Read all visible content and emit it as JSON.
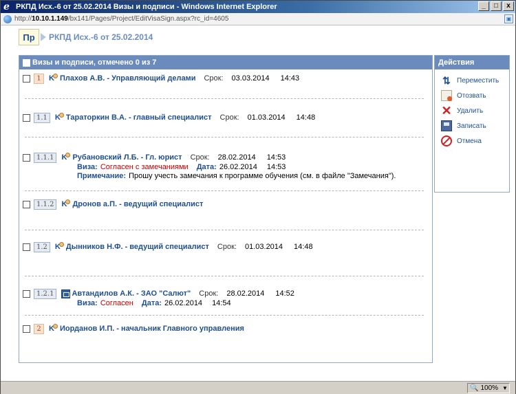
{
  "window": {
    "title": "РКПД Исх.-6 от 25.02.2014 Визы и подписи - Windows Internet Explorer",
    "controls": [
      "_",
      "□",
      "x"
    ]
  },
  "address": {
    "prefix": "http://",
    "host": "10.10.1.149",
    "path": "/bx141/Pages/Project/EditVisaSign.aspx?rc_id=4605"
  },
  "doc": {
    "badge": "Пр",
    "title": "РКПД Исх.-6 от 25.02.2014"
  },
  "panel": {
    "header": "Визы и подписи, отмечено 0 из 7",
    "rows": [
      {
        "num": "1",
        "name": "Плахов А.В. - Управляющий делами",
        "term_label": "Срок:",
        "date": "03.03.2014",
        "time": "14:43"
      },
      {
        "num": "1.1",
        "name": "Тараторкин В.А. - главный специалист",
        "term_label": "Срок:",
        "date": "01.03.2014",
        "time": "14:48"
      },
      {
        "num": "1.1.1",
        "name": "Рубановский Л.Б. - Гл. юрист",
        "term_label": "Срок:",
        "date": "28.02.2014",
        "time": "14:53",
        "visa_label": "Виза:",
        "visa_value": "Согласен с замечаниями",
        "visa_date_label": "Дата:",
        "visa_date": "26.02.2014",
        "visa_time": "14:53",
        "note_label": "Примечание:",
        "note": "Прошу учесть замечания к программе обучения (см. в файле \"Замечания\")."
      },
      {
        "num": "1.1.2",
        "name": "Дронов а.П. - ведущий специалист"
      },
      {
        "num": "1.2",
        "name": "Дынников Н.Ф. - ведущий специалист",
        "term_label": "Срок:",
        "date": "01.03.2014",
        "time": "14:48"
      },
      {
        "num": "1.2.1",
        "name": "Автандилов А.К. - ЗАО \"Салют\"",
        "term_label": "Срок:",
        "date": "28.02.2014",
        "time": "14:52",
        "visa_label": "Виза:",
        "visa_value": "Согласен",
        "visa_date_label": "Дата:",
        "visa_date": "26.02.2014",
        "visa_time": "14:54"
      },
      {
        "num": "2",
        "name": "Иорданов И.П. - начальник Главного управления"
      }
    ]
  },
  "actions": {
    "header": "Действия",
    "items": [
      {
        "label": "Переместить",
        "icon": "move-icon"
      },
      {
        "label": "Отозвать",
        "icon": "recall-icon"
      },
      {
        "label": "Удалить",
        "icon": "delete-icon"
      },
      {
        "label": "Записать",
        "icon": "save-icon"
      },
      {
        "label": "Отмена",
        "icon": "cancel-icon"
      }
    ]
  },
  "status": {
    "zoom": "100%"
  }
}
